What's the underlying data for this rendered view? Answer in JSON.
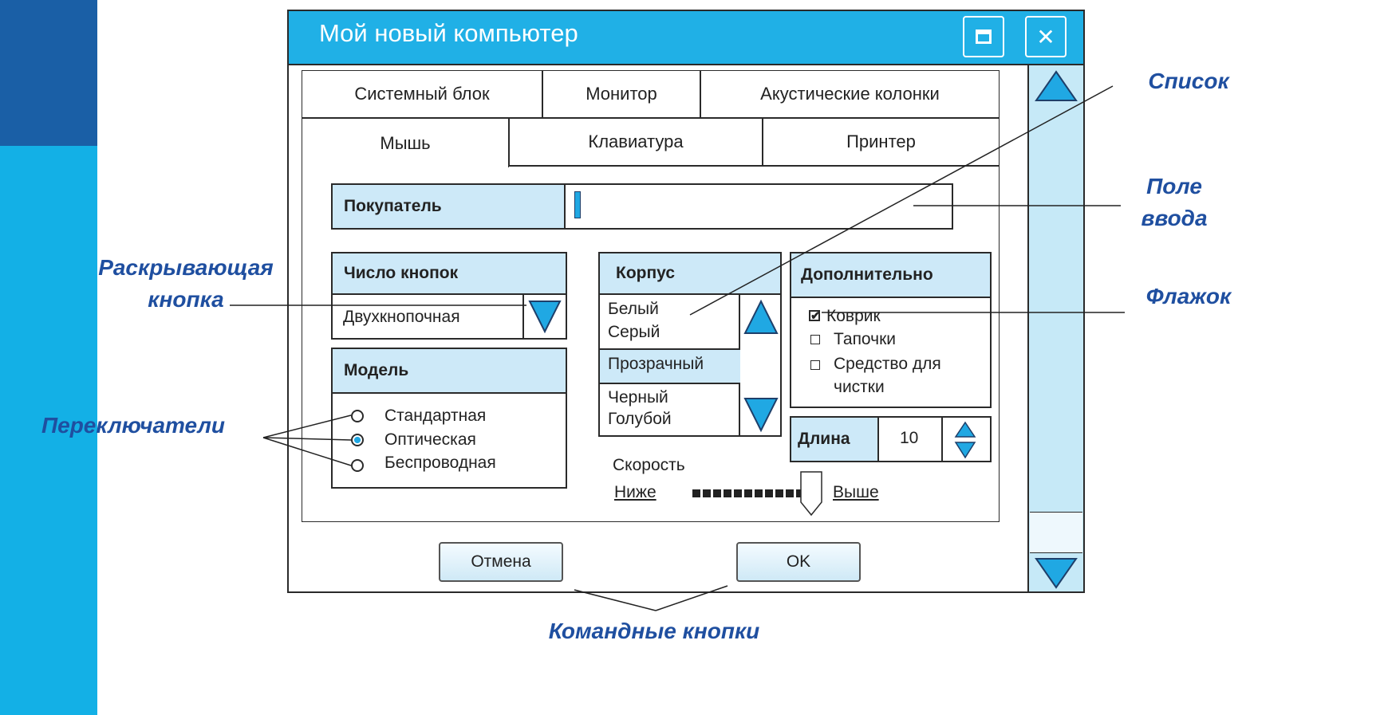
{
  "window": {
    "title": "Мой новый компьютер"
  },
  "tabs_row1": [
    "Системный блок",
    "Монитор",
    "Акустические колонки"
  ],
  "tabs_row2": [
    "Мышь",
    "Клавиатура",
    "Принтер"
  ],
  "buyer": {
    "label": "Покупатель",
    "value": ""
  },
  "buttons_count": {
    "label": "Число кнопок",
    "value": "Двухкнопочная"
  },
  "model": {
    "label": "Модель",
    "options": [
      "Стандартная",
      "Оптическая",
      "Беспроводная"
    ],
    "selected": "Оптическая"
  },
  "case": {
    "label": "Корпус",
    "items": [
      "Белый",
      "Серый",
      "Прозрачный",
      "Черный",
      "Голубой"
    ],
    "selected": "Прозрачный"
  },
  "extra": {
    "label": "Дополнительно",
    "items": [
      "Коврик",
      "Тапочки",
      "Средство для",
      "чистки"
    ],
    "checked": [
      "Коврик"
    ]
  },
  "length": {
    "label": "Длина",
    "value": "10"
  },
  "speed": {
    "label": "Скорость",
    "low": "Ниже",
    "high": "Выше"
  },
  "buttons": {
    "cancel": "Отмена",
    "ok": "OK"
  },
  "callouts": {
    "list": "Список",
    "input_1": "Поле",
    "input_2": "ввода",
    "dropdown_1": "Раскрывающая",
    "dropdown_2": "кнопка",
    "checkbox": "Флажок",
    "radios": "Переключатели",
    "commands": "Командные кнопки"
  },
  "icons": [
    "maximize-icon",
    "close-icon",
    "scroll-up-icon",
    "scroll-down-icon",
    "dropdown-arrow-icon",
    "spin-icon"
  ]
}
